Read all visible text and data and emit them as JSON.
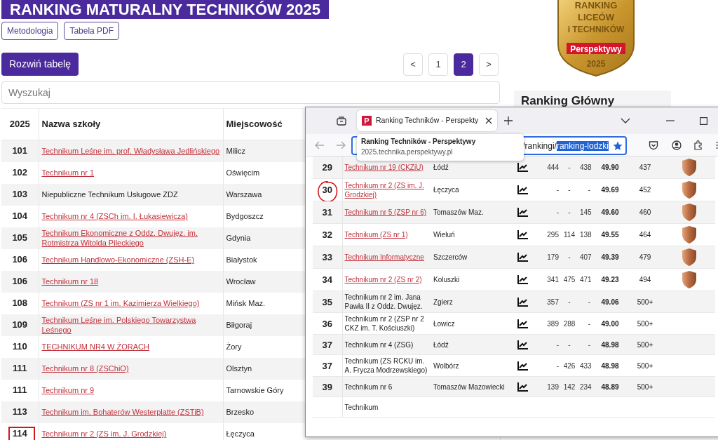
{
  "page": {
    "title": "RANKING MATURALNY TECHNIKÓW 2025",
    "links": [
      "Metodologia",
      "Tabela PDF"
    ],
    "expand_button": "Rozwiń tabelę",
    "pagination": [
      {
        "label": "<",
        "selected": false
      },
      {
        "label": "1",
        "selected": false
      },
      {
        "label": "2",
        "selected": true
      },
      {
        "label": ">",
        "selected": false
      }
    ],
    "search": {
      "placeholder": "Wyszukaj"
    },
    "table": {
      "columns": [
        "2025",
        "Nazwa szkoły",
        "Miejscowość"
      ],
      "rows": [
        {
          "rank": "101",
          "name": "Technikum Leśne im. prof. Władysława Jedlińskiego",
          "link": true,
          "city": "Milicz",
          "marked": false
        },
        {
          "rank": "102",
          "name": "Technikum nr 1",
          "link": true,
          "city": "Oświęcim",
          "marked": false
        },
        {
          "rank": "103",
          "name": "Niepubliczne Technikum Usługowe ZDZ",
          "link": false,
          "city": "Warszawa",
          "marked": false
        },
        {
          "rank": "104",
          "name": "Technikum nr 4 (ZSCh im. I. Łukasiewicza)",
          "link": true,
          "city": "Bydgoszcz",
          "marked": false
        },
        {
          "rank": "105",
          "name": "Technikum Ekonomiczne z Oddz. Dwujęz. im. Rotmistrza Witolda Pileckiego",
          "link": true,
          "city": "Gdynia",
          "marked": false
        },
        {
          "rank": "106",
          "name": "Technikum Handlowo-Ekonomiczne (ZSH-E)",
          "link": true,
          "city": "Białystok",
          "marked": false
        },
        {
          "rank": "106",
          "name": "Technikum nr 18",
          "link": true,
          "city": "Wrocław",
          "marked": false
        },
        {
          "rank": "108",
          "name": "Technikum (ZS nr 1 im. Kazimierza Wielkiego)",
          "link": true,
          "city": "Mińsk Maz.",
          "marked": false
        },
        {
          "rank": "109",
          "name": "Technikum Leśne im. Polskiego Towarzystwa Leśnego",
          "link": true,
          "city": "Biłgoraj",
          "marked": false
        },
        {
          "rank": "110",
          "name": "TECHNIKUM NR4 W ŻORACH",
          "link": true,
          "city": "Żory",
          "marked": false
        },
        {
          "rank": "111",
          "name": "Technikum nr 8 (ZSChiO)",
          "link": true,
          "city": "Olsztyn",
          "marked": false
        },
        {
          "rank": "111",
          "name": "Technikum nr 9",
          "link": true,
          "city": "Tarnowskie Góry",
          "marked": false
        },
        {
          "rank": "113",
          "name": "Technikum im. Bohaterów Westerplatte (ZSTiB)",
          "link": true,
          "city": "Brzesko",
          "marked": false
        },
        {
          "rank": "114",
          "name": "Technikum nr 2 (ZS im. J. Grodzkiej)",
          "link": true,
          "city": "Łęczyca",
          "marked": true
        }
      ]
    }
  },
  "badge": {
    "lines": [
      "RANKING",
      "LICEÓW",
      "i TECHNIKÓW"
    ],
    "brand": "Perspektywy",
    "year": "2025"
  },
  "side_panel": {
    "title": "Ranking Główny"
  },
  "browser": {
    "tab": {
      "favicon": "P",
      "title": "Ranking Techników - Perspekty",
      "selected": true
    },
    "tooltip": {
      "title": "Ranking Techników - Perspektywy",
      "url": "2025.technika.perspektywy.pl"
    },
    "address": {
      "text": "/rankingi/",
      "selected_text": "ranking-lodzki"
    },
    "table": {
      "rows": [
        {
          "rank": "29",
          "name": "Technikum nr 19 (CKZiU)",
          "link": true,
          "city": "Łódź",
          "c1": "444",
          "c2": "-",
          "c3": "438",
          "score": "49.90",
          "rank_2": "437",
          "medal": true,
          "marked": false
        },
        {
          "rank": "30",
          "name": "Technikum nr 2 (ZS im. J. Grodzkiej)",
          "link": true,
          "city": "Łęczyca",
          "c1": "-",
          "c2": "-",
          "c3": "-",
          "score": "49.69",
          "rank_2": "452",
          "medal": true,
          "marked": true
        },
        {
          "rank": "31",
          "name": "Technikum nr 5 (ZSP nr 6)",
          "link": true,
          "city": "Tomaszów Maz.",
          "c1": "-",
          "c2": "-",
          "c3": "145",
          "score": "49.60",
          "rank_2": "460",
          "medal": true,
          "marked": false
        },
        {
          "rank": "32",
          "name": "Technikum (ZS nr 1)",
          "link": true,
          "city": "Wieluń",
          "c1": "295",
          "c2": "114",
          "c3": "138",
          "score": "49.55",
          "rank_2": "464",
          "medal": true,
          "marked": false
        },
        {
          "rank": "33",
          "name": "Technikum Informatyczne",
          "link": true,
          "city": "Szczerców",
          "c1": "179",
          "c2": "-",
          "c3": "407",
          "score": "49.39",
          "rank_2": "479",
          "medal": true,
          "marked": false
        },
        {
          "rank": "34",
          "name": "Technikum nr 2 (ZS nr 2)",
          "link": true,
          "city": "Koluszki",
          "c1": "341",
          "c2": "475",
          "c3": "471",
          "score": "49.23",
          "rank_2": "494",
          "medal": true,
          "marked": false
        },
        {
          "rank": "35",
          "name": "Technikum nr 2 im. Jana Pawła II z Oddz. Dwujęz.",
          "link": false,
          "city": "Zgierz",
          "c1": "357",
          "c2": "-",
          "c3": "-",
          "score": "49.06",
          "rank_2": "500+",
          "medal": false,
          "marked": false
        },
        {
          "rank": "36",
          "name": "Technikum nr 2 (ZSP nr 2 CKZ im. T. Kościuszki)",
          "link": false,
          "city": "Łowicz",
          "c1": "389",
          "c2": "288",
          "c3": "-",
          "score": "49.00",
          "rank_2": "500+",
          "medal": false,
          "marked": false
        },
        {
          "rank": "37",
          "name": "Technikum nr 4 (ZSG)",
          "link": false,
          "city": "Łódź",
          "c1": "-",
          "c2": "-",
          "c3": "-",
          "score": "48.98",
          "rank_2": "500+",
          "medal": false,
          "marked": false
        },
        {
          "rank": "37",
          "name": "Technikum (ZS RCKU im. A. Frycza Modrzewskiego)",
          "link": false,
          "city": "Wolbórz",
          "c1": "-",
          "c2": "426",
          "c3": "433",
          "score": "48.98",
          "rank_2": "500+",
          "medal": false,
          "marked": false
        },
        {
          "rank": "39",
          "name": "Technikum nr 6",
          "link": false,
          "city": "Tomaszów Mazowiecki",
          "c1": "139",
          "c2": "142",
          "c3": "234",
          "score": "48.89",
          "rank_2": "500+",
          "medal": false,
          "marked": false
        },
        {
          "name": "Technikum",
          "link": false
        }
      ]
    }
  }
}
